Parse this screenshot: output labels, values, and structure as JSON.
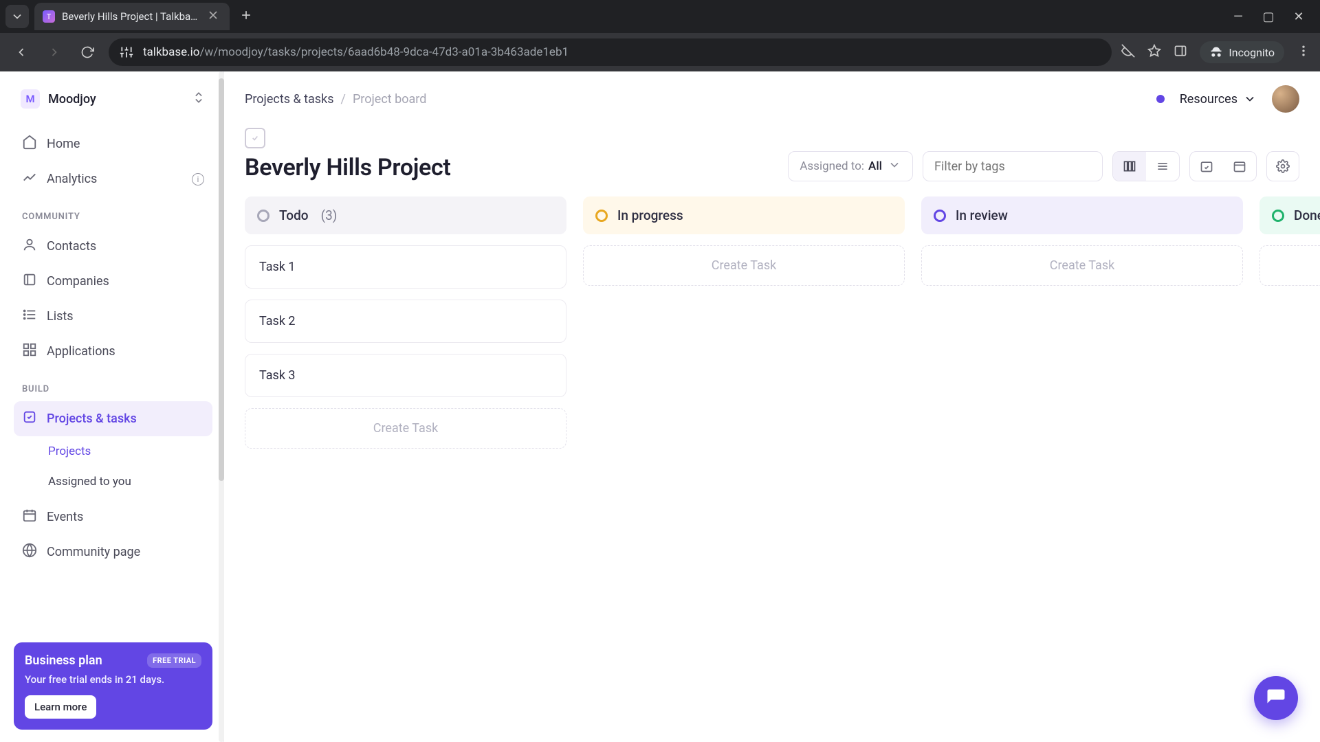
{
  "browser": {
    "tab_title": "Beverly Hills Project | Talkbase.",
    "url_domain": "talkbase.io",
    "url_path": "/w/moodjoy/tasks/projects/6aad6b48-9dca-47d3-a01a-3b463ade1eb1",
    "incognito_label": "Incognito"
  },
  "workspace": {
    "initial": "M",
    "name": "Moodjoy"
  },
  "nav": {
    "home": "Home",
    "analytics": "Analytics",
    "community_label": "COMMUNITY",
    "contacts": "Contacts",
    "companies": "Companies",
    "lists": "Lists",
    "applications": "Applications",
    "build_label": "BUILD",
    "projects_tasks": "Projects & tasks",
    "projects": "Projects",
    "assigned_to_you": "Assigned to you",
    "events": "Events",
    "community_page": "Community page"
  },
  "promo": {
    "title": "Business plan",
    "chip": "FREE TRIAL",
    "subtitle": "Your free trial ends in 21 days.",
    "button": "Learn more"
  },
  "breadcrumb": {
    "root": "Projects & tasks",
    "current": "Project board"
  },
  "topbar": {
    "resources": "Resources"
  },
  "board": {
    "title": "Beverly Hills Project",
    "assigned_label": "Assigned to:",
    "assigned_value": "All",
    "filter_placeholder": "Filter by tags"
  },
  "columns": {
    "todo": {
      "title": "Todo",
      "count": "(3)"
    },
    "in_progress": {
      "title": "In progress"
    },
    "in_review": {
      "title": "In review"
    },
    "done": {
      "title": "Done"
    }
  },
  "tasks": {
    "t1": "Task 1",
    "t2": "Task 2",
    "t3": "Task 3"
  },
  "create_task_label": "Create Task"
}
